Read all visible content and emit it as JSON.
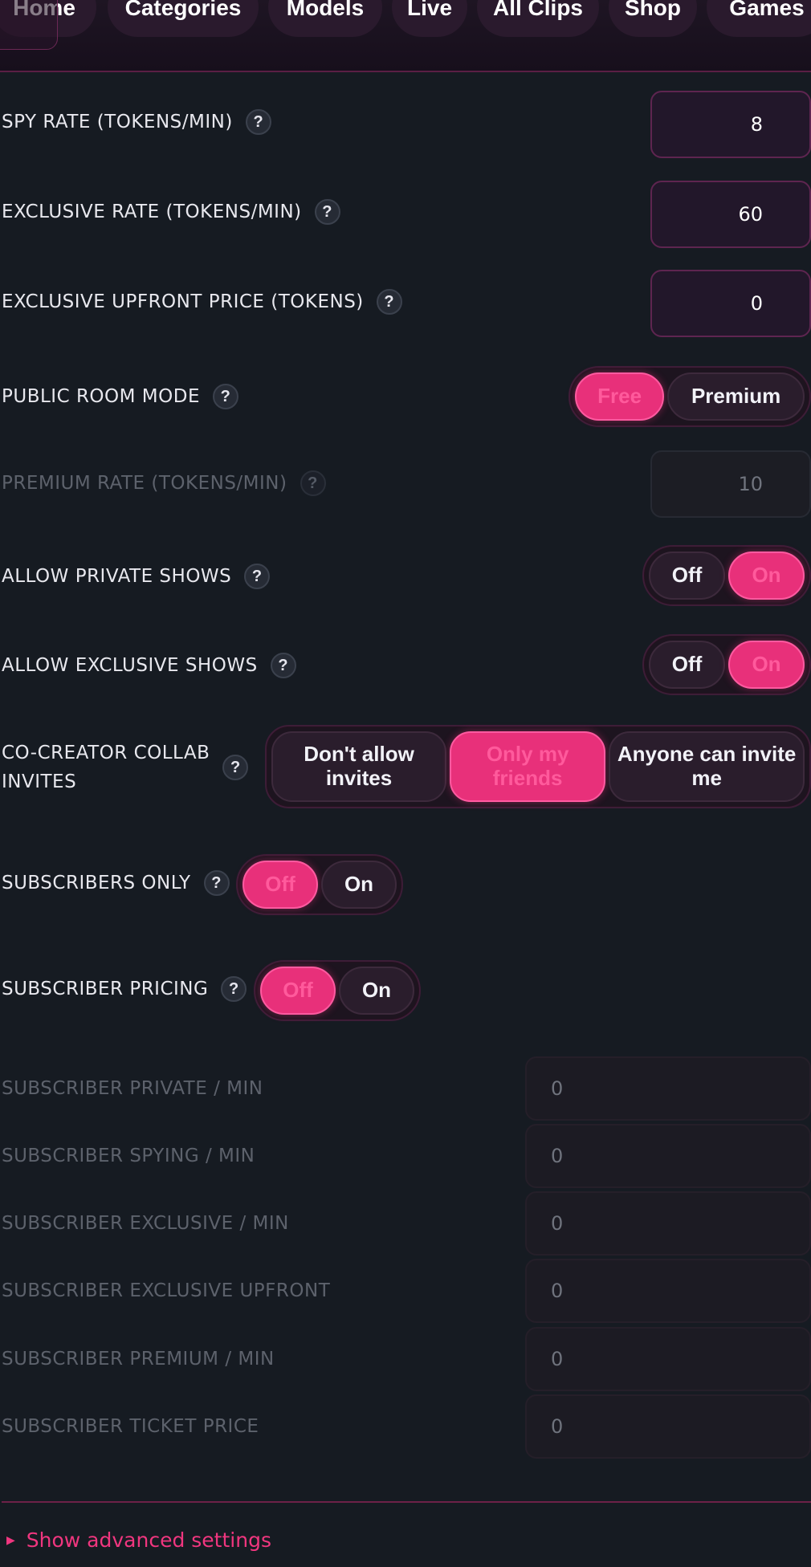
{
  "nav": {
    "items": [
      "Home",
      "Categories",
      "Models",
      "Live",
      "All Clips",
      "Shop",
      "Games"
    ]
  },
  "settings": {
    "spy_rate": {
      "label": "SPY RATE (TOKENS/MIN)",
      "value": "8"
    },
    "exclusive_rate": {
      "label": "EXCLUSIVE RATE (TOKENS/MIN)",
      "value": "60"
    },
    "exclusive_upfront": {
      "label": "EXCLUSIVE UPFRONT PRICE (TOKENS)",
      "value": "0"
    },
    "public_room_mode": {
      "label": "PUBLIC ROOM MODE",
      "options": [
        "Free",
        "Premium"
      ],
      "selected": "Free"
    },
    "premium_rate": {
      "label": "PREMIUM RATE (TOKENS/MIN)",
      "value": "10"
    },
    "allow_private": {
      "label": "ALLOW PRIVATE SHOWS",
      "options": [
        "Off",
        "On"
      ],
      "selected": "On"
    },
    "allow_exclusive": {
      "label": "ALLOW EXCLUSIVE SHOWS",
      "options": [
        "Off",
        "On"
      ],
      "selected": "On"
    },
    "collab_invites": {
      "label_line1": "CO-CREATOR COLLAB",
      "label_line2": "INVITES",
      "options": [
        "Don't allow invites",
        "Only my friends",
        "Anyone can invite me"
      ],
      "selected": "Only my friends"
    },
    "subscribers_only": {
      "label": "SUBSCRIBERS ONLY",
      "options": [
        "Off",
        "On"
      ],
      "selected": "Off"
    },
    "subscriber_pricing": {
      "label": "SUBSCRIBER PRICING",
      "options": [
        "Off",
        "On"
      ],
      "selected": "Off"
    },
    "subscriber_fields": [
      {
        "label": "SUBSCRIBER PRIVATE / MIN",
        "value": "0"
      },
      {
        "label": "SUBSCRIBER SPYING / MIN",
        "value": "0"
      },
      {
        "label": "SUBSCRIBER EXCLUSIVE / MIN",
        "value": "0"
      },
      {
        "label": "SUBSCRIBER EXCLUSIVE UPFRONT",
        "value": "0"
      },
      {
        "label": "SUBSCRIBER PREMIUM / MIN",
        "value": "0"
      },
      {
        "label": "SUBSCRIBER TICKET PRICE",
        "value": "0"
      }
    ]
  },
  "help_glyph": "?",
  "advanced": {
    "label": "Show advanced settings",
    "icon": "triangle-right-icon"
  },
  "colors": {
    "accent": "#e8307a",
    "background": "#161b22"
  }
}
